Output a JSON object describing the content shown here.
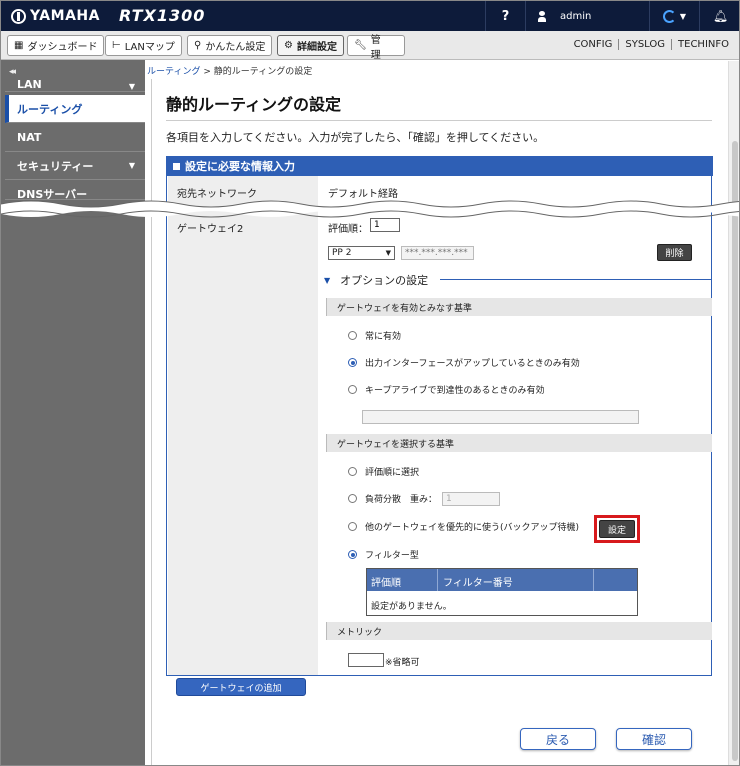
{
  "header": {
    "brand": "YAMAHA",
    "model": "RTX1300",
    "help": "?",
    "user": "admin"
  },
  "nav": {
    "buttons": [
      {
        "label": "ダッシュボード",
        "icon": "dashboard-icon"
      },
      {
        "label": "LANマップ",
        "icon": "lan-map-icon"
      },
      {
        "label": "かんたん設定",
        "icon": "wizard-icon"
      },
      {
        "label": "詳細設定",
        "icon": "gear-icon"
      },
      {
        "label": "管　理",
        "icon": "wrench-icon"
      }
    ],
    "links": [
      "CONFIG",
      "SYSLOG",
      "TECHINFO"
    ]
  },
  "sidebar": {
    "collapse": "◂◂",
    "items": [
      {
        "label": "LAN"
      },
      {
        "label": "ルーティング"
      },
      {
        "label": "NAT"
      },
      {
        "label": "セキュリティー"
      },
      {
        "label": "DNSサーバー"
      }
    ]
  },
  "breadcrumb": {
    "link": "ルーティング",
    "sep": ">",
    "current": "静的ルーティングの設定"
  },
  "main": {
    "title": "静的ルーティングの設定",
    "intro": "各項目を入力してください。入力が完了したら、「確認」を押してください。",
    "section_title": "設定に必要な情報入力",
    "dest_label": "宛先ネットワーク",
    "dest_value": "デフォルト経路",
    "gateway_label": "ゲートウェイ2",
    "priority_label": "評価順：",
    "priority_value": "1",
    "interface_value": "PP 2",
    "ip_placeholder": "***.***.***.***",
    "delete_label": "削除",
    "option_title": "オプションの設定",
    "valid_head": "ゲートウェイを有効とみなす基準",
    "valid_options": [
      "常に有効",
      "出力インターフェースがアップしているときのみ有効",
      "キープアライブで到達性のあるときのみ有効"
    ],
    "select_head": "ゲートウェイを選択する基準",
    "select_options": [
      "評価順に選択",
      "負荷分散　重み：",
      "他のゲートウェイを優先的に使う(バックアップ待機)",
      "フィルター型"
    ],
    "weight_value": "1",
    "filter_table": {
      "col_priority": "評価順",
      "col_filter": "フィルター番号",
      "empty": "設定がありません。",
      "set_label": "設定"
    },
    "metric_head": "メトリック",
    "metric_note": "※省略可",
    "add_gateway": "ゲートウェイの追加",
    "back": "戻る",
    "confirm": "確認"
  }
}
